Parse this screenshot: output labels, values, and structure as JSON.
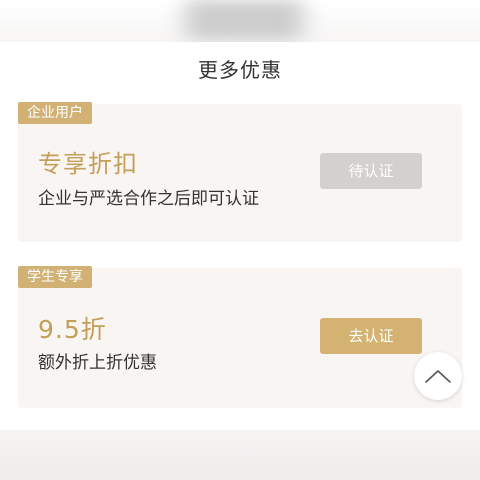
{
  "section": {
    "title": "更多优惠"
  },
  "cards": [
    {
      "badge": "企业用户",
      "title": "专享折扣",
      "description": "企业与严选合作之后即可认证",
      "button": "待认证",
      "button_state": "disabled"
    },
    {
      "badge": "学生专享",
      "title": "9.5折",
      "description": "额外折上折优惠",
      "button": "去认证",
      "button_state": "enabled"
    }
  ],
  "icons": {
    "scroll_top": "chevron-up-icon"
  },
  "colors": {
    "accent_gold": "#d2b174",
    "title_gold": "#c39f5a",
    "disabled_gray": "#d3d0ce",
    "card_bg": "#f8f5f2"
  }
}
